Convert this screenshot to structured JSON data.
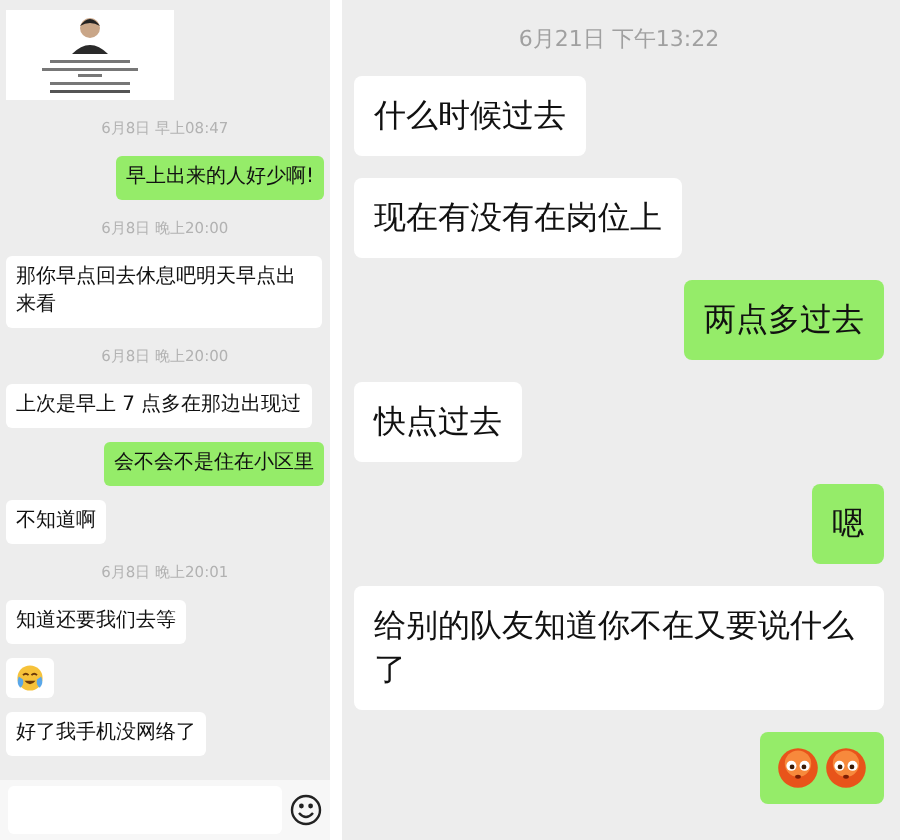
{
  "left_chat": {
    "messages": [
      {
        "kind": "picture"
      },
      {
        "kind": "timestamp",
        "text": "6月8日 早上08:47"
      },
      {
        "kind": "text",
        "outgoing": true,
        "text": "早上出来的人好少啊!"
      },
      {
        "kind": "timestamp",
        "text": "6月8日 晚上20:00"
      },
      {
        "kind": "text",
        "outgoing": false,
        "text": "那你早点回去休息吧明天早点出来看"
      },
      {
        "kind": "timestamp",
        "text": "6月8日 晚上20:00"
      },
      {
        "kind": "text",
        "outgoing": false,
        "text": "上次是早上 7 点多在那边出现过"
      },
      {
        "kind": "text",
        "outgoing": true,
        "text": "会不会不是住在小区里"
      },
      {
        "kind": "text",
        "outgoing": false,
        "text": "不知道啊"
      },
      {
        "kind": "timestamp",
        "text": "6月8日 晚上20:01"
      },
      {
        "kind": "text",
        "outgoing": false,
        "text": "知道还要我们去等"
      },
      {
        "kind": "crying-laugh",
        "outgoing": false
      },
      {
        "kind": "text",
        "outgoing": false,
        "text": "好了我手机没网络了"
      }
    ],
    "input_bar": {
      "kind": "text-input"
    }
  },
  "right_chat": {
    "messages": [
      {
        "kind": "timestamp",
        "text": "6月21日 下午13:22"
      },
      {
        "kind": "text",
        "outgoing": false,
        "text": "什么时候过去"
      },
      {
        "kind": "text",
        "outgoing": false,
        "text": "现在有没有在岗位上"
      },
      {
        "kind": "text",
        "outgoing": true,
        "text": "两点多过去"
      },
      {
        "kind": "text",
        "outgoing": false,
        "text": "快点过去"
      },
      {
        "kind": "text",
        "outgoing": true,
        "text": "嗯"
      },
      {
        "kind": "text",
        "outgoing": false,
        "text": "给别的队友知道你不在又要说什么了"
      },
      {
        "kind": "blush-pair",
        "outgoing": true
      }
    ]
  }
}
